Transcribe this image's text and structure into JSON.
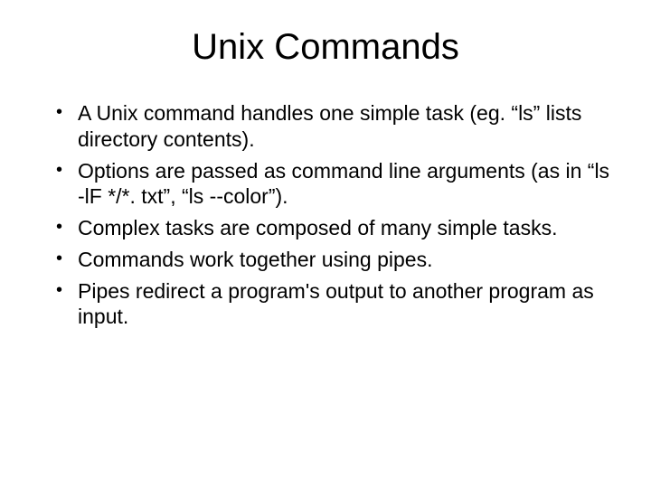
{
  "slide": {
    "title": "Unix Commands",
    "bullets": [
      "A Unix command handles one simple task (eg. “ls” lists directory contents).",
      "Options are passed as command line arguments (as in “ls -lF */*. txt”, “ls --color”).",
      "Complex tasks are composed of many simple tasks.",
      "Commands work together using pipes.",
      "Pipes redirect a program's output to another program as input."
    ]
  }
}
